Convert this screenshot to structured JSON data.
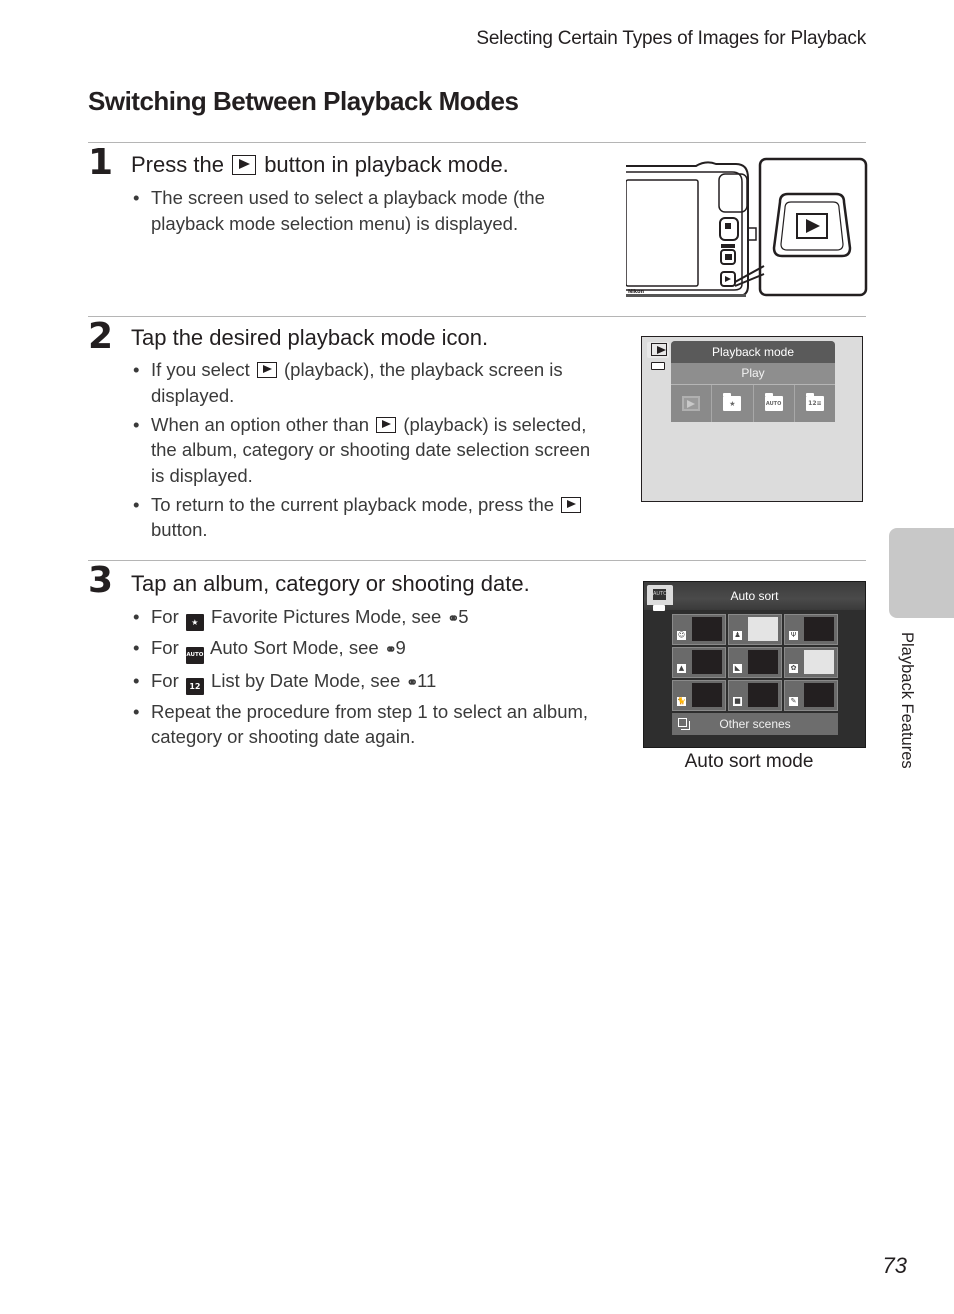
{
  "running_head": "Selecting Certain Types of Images for Playback",
  "page_title": "Switching Between Playback Modes",
  "steps": [
    {
      "number": "1",
      "title_pre": "Press the",
      "title_post": "button in playback mode.",
      "bullets": [
        {
          "text": "The screen used to select a playback mode (the playback mode selection menu) is displayed."
        }
      ]
    },
    {
      "number": "2",
      "title": "Tap the desired playback mode icon.",
      "bullets": [
        {
          "pre": "If you select",
          "post": "(playback), the playback screen is displayed."
        },
        {
          "pre": "When an option other than",
          "post": "(playback) is selected, the album, category or shooting date selection screen is displayed."
        },
        {
          "pre": "To return to the current playback mode, press the",
          "post": "button."
        }
      ]
    },
    {
      "number": "3",
      "title": "Tap an album, category or shooting date.",
      "bullets": [
        {
          "pre": "For",
          "icon": "★",
          "icon_name": "favorite-pictures-icon",
          "post": "Favorite Pictures Mode, see",
          "ref_icon": "ȸ",
          "ref": "5"
        },
        {
          "pre": "For",
          "icon": "AUTO",
          "icon_name": "auto-sort-icon",
          "post": "Auto Sort Mode, see",
          "ref_icon": "ȸ",
          "ref": "9"
        },
        {
          "pre": "For",
          "icon": "12",
          "icon_name": "list-by-date-icon",
          "post": "List by Date Mode, see",
          "ref_icon": "ȸ",
          "ref": "11"
        },
        {
          "text": "Repeat the procedure from step 1 to select an album, category or shooting date again."
        }
      ]
    }
  ],
  "camera_figure": {
    "brand_text": "Nikon",
    "highlighted_button": "playback-button"
  },
  "playback_menu_screen": {
    "header": "Playback mode",
    "selected": "Play",
    "icons": [
      "play-icon",
      "favorite-pictures-icon",
      "auto-sort-icon",
      "list-by-date-icon"
    ],
    "icon_labels": [
      "",
      "★",
      "AUTO",
      "12≡"
    ]
  },
  "auto_sort_screen": {
    "header": "Auto sort",
    "mode_label": "AUTO",
    "categories": [
      {
        "name": "smile-portrait",
        "glyph": "☺",
        "has_photo": false
      },
      {
        "name": "portraits",
        "glyph": "♟",
        "has_photo": true
      },
      {
        "name": "food",
        "glyph": "Ψ",
        "has_photo": false
      },
      {
        "name": "landscape",
        "glyph": "▲",
        "has_photo": false
      },
      {
        "name": "dusk-to-dawn",
        "glyph": "◣",
        "has_photo": false
      },
      {
        "name": "close-ups",
        "glyph": "✿",
        "has_photo": true
      },
      {
        "name": "pet-portrait",
        "glyph": "🐈",
        "has_photo": false
      },
      {
        "name": "movie",
        "glyph": "■",
        "has_photo": false
      },
      {
        "name": "retouched-copies",
        "glyph": "✎",
        "has_photo": false
      }
    ],
    "other_label": "Other scenes",
    "caption": "Auto sort mode"
  },
  "side_tab_label": "Playback Features",
  "page_number": "73"
}
